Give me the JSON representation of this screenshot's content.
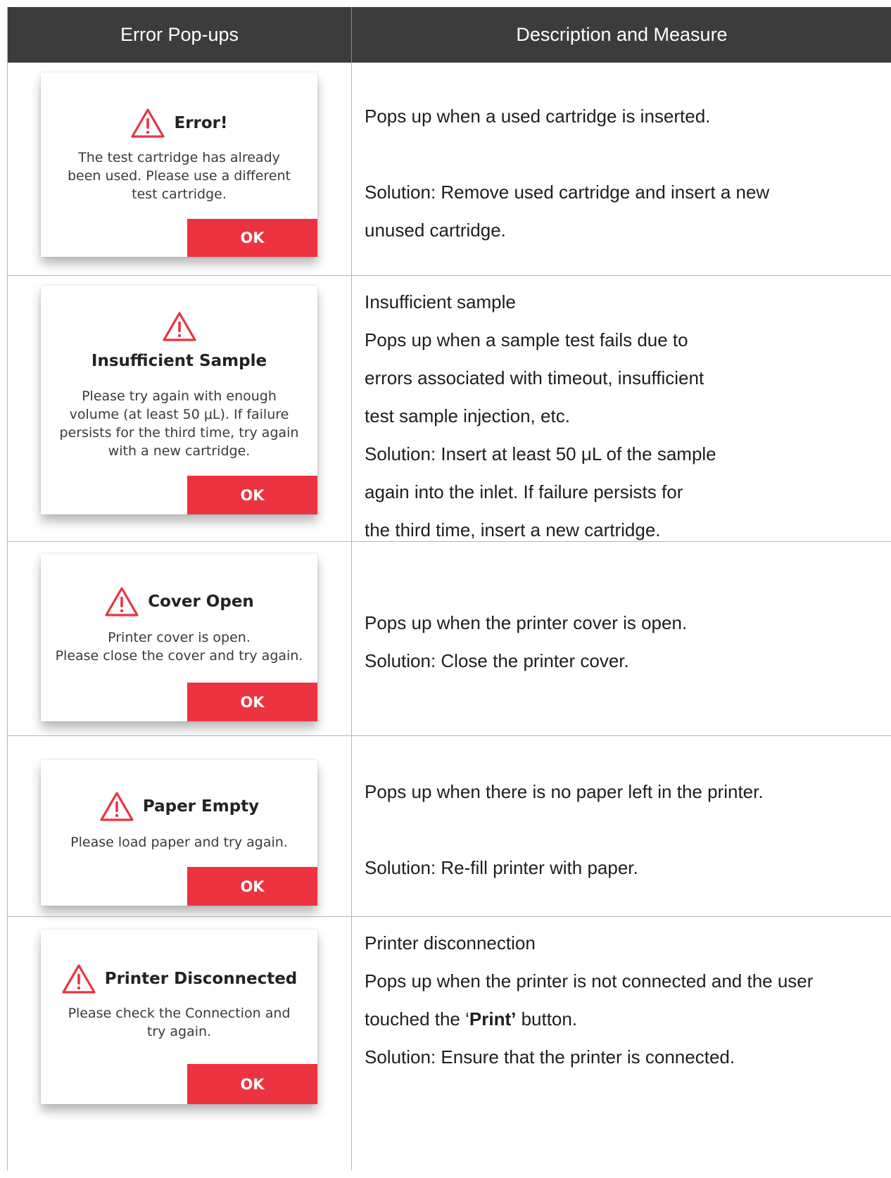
{
  "header": {
    "col_left": "Error Pop-ups",
    "col_right": "Description and Measure"
  },
  "rows": [
    {
      "popup": {
        "title": "Error!",
        "body": [
          "The test cartridge has already",
          "been used. Please use a different",
          "test cartridge."
        ],
        "button": "OK",
        "icon": "warning-triangle-icon"
      },
      "description": [
        "Pops up when a used cartridge is inserted.",
        "",
        "Solution: Remove used cartridge and insert a new",
        "unused cartridge."
      ]
    },
    {
      "popup": {
        "title": "Insufficient Sample",
        "body": [
          "Please try again with enough",
          "volume (at least 50 μL). If failure",
          "persists for the third time, try again",
          "with a new cartridge."
        ],
        "button": "OK",
        "icon": "warning-triangle-icon"
      },
      "description": [
        "Insufficient sample",
        "Pops up when a sample test fails due to",
        "errors associated with timeout, insufficient",
        "test sample injection, etc.",
        "Solution: Insert at least 50 μL of the sample",
        "again into the inlet. If failure persists for",
        "the third time, insert a new cartridge."
      ]
    },
    {
      "popup": {
        "title": "Cover Open",
        "body": [
          "Printer cover is open.",
          "Please close the cover and try again."
        ],
        "button": "OK",
        "icon": "warning-triangle-icon"
      },
      "description": [
        "Pops up when the printer cover is open.",
        "Solution: Close the printer cover."
      ]
    },
    {
      "popup": {
        "title": "Paper Empty",
        "body": [
          "Please load paper and try again."
        ],
        "button": "OK",
        "icon": "warning-triangle-icon"
      },
      "description": [
        "Pops up when there is no paper left in the printer.",
        "",
        "Solution: Re-fill printer with paper."
      ]
    },
    {
      "popup": {
        "title": "Printer Disconnected",
        "body": [
          "Please check the Connection and",
          "try again."
        ],
        "button": "OK",
        "icon": "warning-triangle-icon"
      },
      "description_line1": "Printer disconnection",
      "description_line2": "Pops up when the printer is not connected and the user",
      "description_line3_pre": "touched the ‘",
      "description_line3_bold": "Print’",
      "description_line3_post": " button.",
      "description_line4": "Solution: Ensure that the printer is connected."
    }
  ],
  "colors": {
    "header_bg": "#3c3c3c",
    "ok_button": "#ee3340",
    "warning_red": "#e8343f"
  }
}
